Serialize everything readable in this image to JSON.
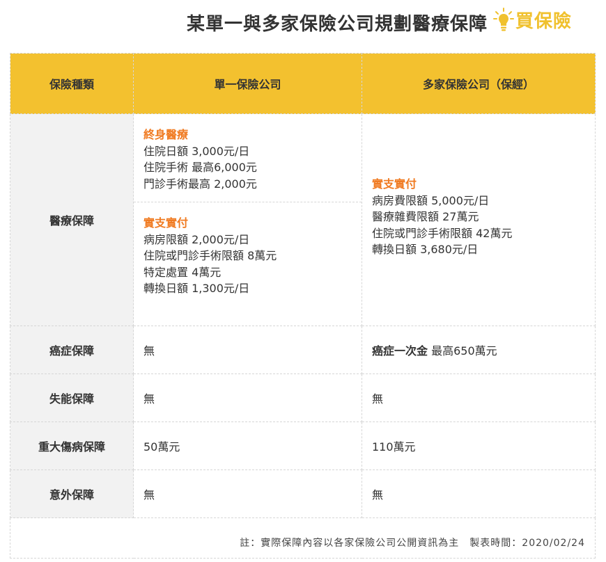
{
  "title": "某單一與多家保險公司規劃醫療保障",
  "logo": {
    "text": "買保險",
    "icon": "lightbulb-icon",
    "color": "#F0C12E"
  },
  "colors": {
    "header_bg": "#F3C12F",
    "highlight": "#F07B22",
    "rowhead_bg": "#f2f2f2"
  },
  "table": {
    "headers": [
      "保險種類",
      "單一保險公司",
      "多家保險公司（保經）"
    ],
    "medical": {
      "label": "醫療保障",
      "single": {
        "block1": {
          "heading": "終身醫療",
          "lines": [
            "住院日額 3,000元/日",
            "住院手術 最高6,000元",
            "門診手術最高 2,000元"
          ]
        },
        "block2": {
          "heading": "實支實付",
          "lines": [
            "病房限額 2,000元/日",
            "住院或門診手術限額 8萬元",
            "特定處置 4萬元",
            "轉換日額 1,300元/日"
          ]
        }
      },
      "multi": {
        "heading": "實支實付",
        "lines": [
          "病房費限額 5,000元/日",
          "醫療雜費限額 27萬元",
          "住院或門診手術限額 42萬元",
          "轉換日額 3,680元/日"
        ]
      }
    },
    "cancer": {
      "label": "癌症保障",
      "single": "無",
      "multi_bold": "癌症一次金",
      "multi_rest": " 最高650萬元"
    },
    "disability": {
      "label": "失能保障",
      "single": "無",
      "multi": "無"
    },
    "major_injury": {
      "label": "重大傷病保障",
      "single": "50萬元",
      "multi": "110萬元"
    },
    "accident": {
      "label": "意外保障",
      "single": "無",
      "multi": "無"
    }
  },
  "note": "註：實際保障內容以各家保險公司公開資訊為主　製表時間：2020/02/24"
}
